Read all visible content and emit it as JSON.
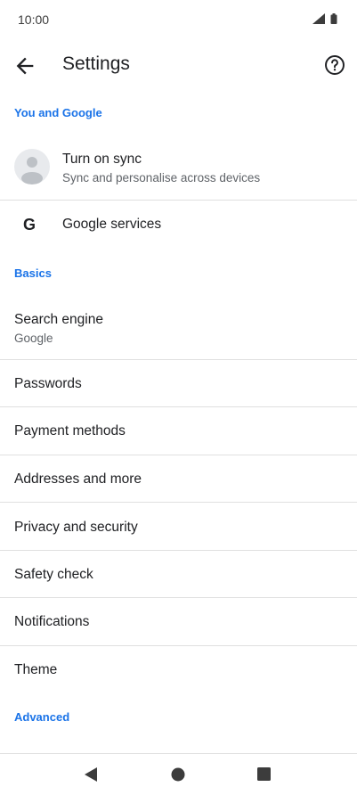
{
  "status_bar": {
    "time": "10:00"
  },
  "app_bar": {
    "title": "Settings"
  },
  "sections": {
    "you_and_google": "You and Google",
    "basics": "Basics",
    "advanced": "Advanced"
  },
  "sync": {
    "title": "Turn on sync",
    "subtitle": "Sync and personalise across devices"
  },
  "google_services": {
    "label": "Google services",
    "icon_letter": "G"
  },
  "basics_items": {
    "search_engine": {
      "label": "Search engine",
      "value": "Google"
    },
    "passwords": "Passwords",
    "payment_methods": "Payment methods",
    "addresses": "Addresses and more",
    "privacy": "Privacy and security",
    "safety_check": "Safety check",
    "notifications": "Notifications",
    "theme": "Theme"
  },
  "colors": {
    "accent": "#1a73e8",
    "text": "#202124",
    "secondary_text": "#5f6368",
    "divider": "#e0e0e0"
  }
}
